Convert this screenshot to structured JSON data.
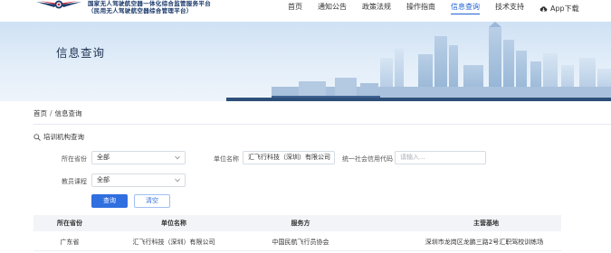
{
  "header": {
    "brand_line1": "国家无人驾驶航空器一体化综合监管服务平台",
    "brand_line2": "（民用无人驾驶航空器综合管理平台）",
    "nav": [
      {
        "label": "首页",
        "active": false
      },
      {
        "label": "通知公告",
        "active": false
      },
      {
        "label": "政策法规",
        "active": false
      },
      {
        "label": "操作指南",
        "active": false
      },
      {
        "label": "信息查询",
        "active": true
      },
      {
        "label": "技术支持",
        "active": false
      }
    ],
    "app_download": "App下载",
    "accent_color": "#1f63d6"
  },
  "banner": {
    "title": "信息查询"
  },
  "breadcrumb": {
    "home": "首页",
    "separator": "/",
    "current": "信息查询"
  },
  "section": {
    "title": "培训机构查询"
  },
  "form": {
    "province_label": "所在省份",
    "province_value": "全部",
    "unit_label": "单位名称",
    "unit_value": "汇飞行科技（深圳）有限公司",
    "credit_label": "统一社会信用代码",
    "credit_placeholder": "请输入...",
    "course_label": "教员课程",
    "course_value": "全部",
    "search_button": "查询",
    "reset_button": "清空"
  },
  "table": {
    "headers": [
      "所在省份",
      "单位名称",
      "服务方",
      "主营基地"
    ],
    "rows": [
      [
        "广东省",
        "汇飞行科技（深圳）有限公司",
        "中国民航飞行员协会",
        "深圳市龙岗区龙鹏三路2号汇职驾校训练场"
      ]
    ]
  }
}
